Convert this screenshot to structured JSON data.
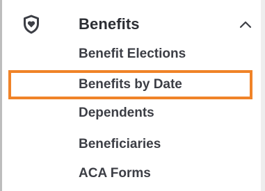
{
  "nav": {
    "section": {
      "title": "Benefits",
      "icon": "shield-heart-icon",
      "expanded": true,
      "toggle_icon": "chevron-up-icon"
    },
    "items": [
      {
        "label": "Benefit Elections"
      },
      {
        "label": "Benefits by Date",
        "highlighted": true
      },
      {
        "label": "Dependents"
      },
      {
        "label": "Beneficiaries"
      },
      {
        "label": "ACA Forms"
      }
    ]
  },
  "colors": {
    "highlight_border": "#f08328",
    "text": "#3c3e45",
    "background": "#ffffff",
    "sidebar_border": "#bdbdbd"
  }
}
